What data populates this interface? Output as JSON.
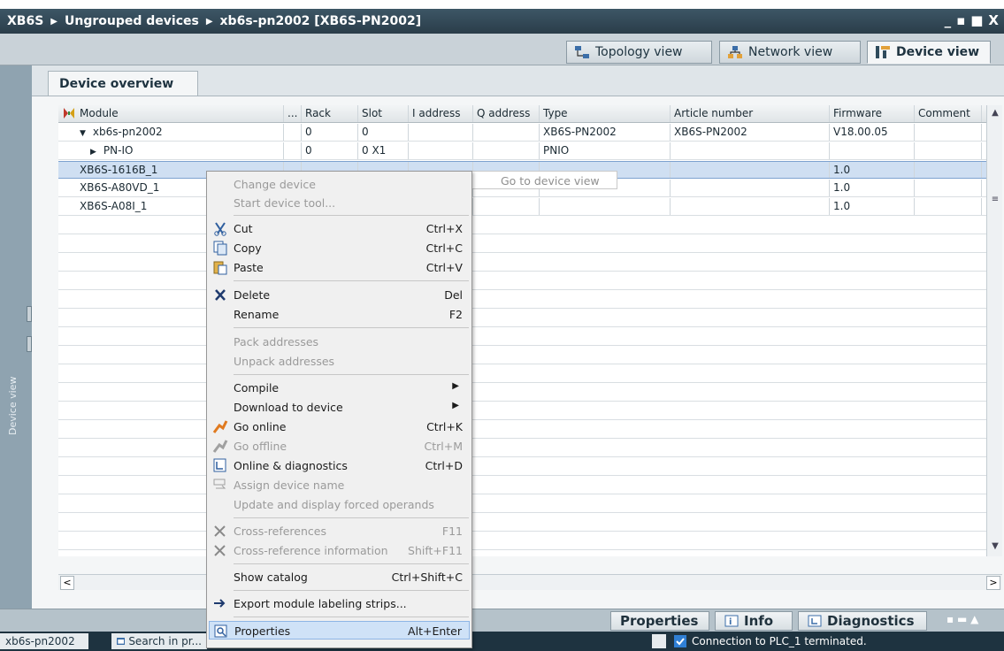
{
  "titlebar": {
    "breadcrumb": [
      "XB6S",
      "Ungrouped devices",
      "xb6s-pn2002 [XB6S-PN2002]"
    ],
    "window_controls": [
      "_",
      "▪",
      "■",
      "X"
    ]
  },
  "view_tabs": [
    {
      "label": "Topology view",
      "icon": "topology-icon"
    },
    {
      "label": "Network view",
      "icon": "network-icon"
    },
    {
      "label": "Device view",
      "icon": "device-icon",
      "active": true
    }
  ],
  "left_strip": {
    "label": "Device view"
  },
  "overview_tab": "Device overview",
  "table": {
    "columns": [
      "Module",
      "...",
      "Rack",
      "Slot",
      "I address",
      "Q address",
      "Type",
      "Article number",
      "Firmware",
      "Comment"
    ],
    "rows": [
      {
        "module": "xb6s-pn2002",
        "expander": "▼",
        "rack": "0",
        "slot": "0",
        "iaddr": "",
        "qaddr": "",
        "type": "XB6S-PN2002",
        "article": "XB6S-PN2002",
        "firmware": "V18.00.05",
        "comment": ""
      },
      {
        "module": "PN-IO",
        "expander": "▶",
        "rack": "0",
        "slot": "0 X1",
        "iaddr": "",
        "qaddr": "",
        "type": "PNIO",
        "article": "",
        "firmware": "",
        "comment": ""
      },
      {
        "module": "XB6S-1616B_1",
        "expander": "",
        "rack": "",
        "slot": "",
        "iaddr": "",
        "qaddr": "",
        "type": "",
        "article": "",
        "firmware": "1.0",
        "comment": "",
        "selected": true
      },
      {
        "module": "XB6S-A80VD_1",
        "expander": "",
        "rack": "",
        "slot": "",
        "iaddr": "",
        "qaddr": "",
        "type": "",
        "article": "",
        "firmware": "1.0",
        "comment": ""
      },
      {
        "module": "XB6S-A08I_1",
        "expander": "",
        "rack": "",
        "slot": "",
        "iaddr": "",
        "qaddr": "",
        "type": "",
        "article": "",
        "firmware": "1.0",
        "comment": ""
      }
    ]
  },
  "context_menu": {
    "items": [
      {
        "label": "Change device",
        "disabled": true
      },
      {
        "label": "Start device tool...",
        "disabled": true
      },
      {
        "label": "Cut",
        "shortcut": "Ctrl+X",
        "icon": "cut-icon"
      },
      {
        "label": "Copy",
        "shortcut": "Ctrl+C",
        "icon": "copy-icon"
      },
      {
        "label": "Paste",
        "shortcut": "Ctrl+V",
        "icon": "paste-icon"
      },
      {
        "label": "Delete",
        "shortcut": "Del",
        "icon": "delete-icon"
      },
      {
        "label": "Rename",
        "shortcut": "F2"
      },
      {
        "label": "Pack addresses",
        "disabled": true
      },
      {
        "label": "Unpack addresses",
        "disabled": true
      },
      {
        "label": "Compile",
        "submenu": true
      },
      {
        "label": "Download to device",
        "submenu": true
      },
      {
        "label": "Go online",
        "shortcut": "Ctrl+K",
        "icon": "go-online-icon"
      },
      {
        "label": "Go offline",
        "shortcut": "Ctrl+M",
        "icon": "go-offline-icon",
        "disabled": true
      },
      {
        "label": "Online & diagnostics",
        "shortcut": "Ctrl+D",
        "icon": "diagnostics-icon"
      },
      {
        "label": "Assign device name",
        "icon": "assign-name-icon",
        "disabled": true
      },
      {
        "label": "Update and display forced operands",
        "disabled": true
      },
      {
        "label": "Cross-references",
        "shortcut": "F11",
        "icon": "cross-ref-icon",
        "disabled": true
      },
      {
        "label": "Cross-reference information",
        "shortcut": "Shift+F11",
        "icon": "cross-ref-info-icon",
        "disabled": true
      },
      {
        "label": "Show catalog",
        "shortcut": "Ctrl+Shift+C"
      },
      {
        "label": "Export module labeling strips...",
        "icon": "export-icon"
      },
      {
        "label": "Properties",
        "shortcut": "Alt+Enter",
        "icon": "properties-icon",
        "highlighted": true
      }
    ],
    "tooltip": "Go to device view"
  },
  "bottom_tabs": [
    {
      "label": "Properties"
    },
    {
      "label": "Info",
      "icon": "info-icon"
    },
    {
      "label": "Diagnostics",
      "icon": "diagnostics-icon"
    }
  ],
  "status": {
    "item1": "xb6s-pn2002",
    "item2": "Search in pr...",
    "message": "Connection to PLC_1 terminated."
  },
  "colors": {
    "accent": "#1e3340",
    "selection": "#cfdff2",
    "menu_highlight": "#cfe2f7"
  }
}
